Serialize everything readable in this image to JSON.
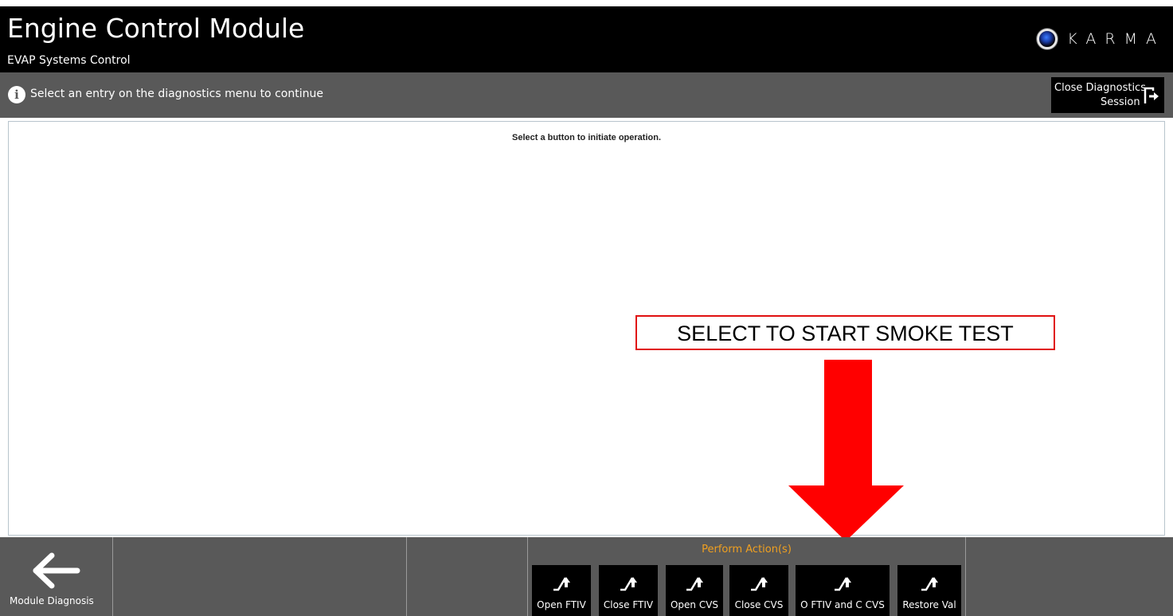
{
  "header": {
    "title": "Engine Control Module",
    "subtitle": "EVAP Systems Control",
    "brand": "KARMA"
  },
  "infobar": {
    "message": "Select an entry on the diagnostics menu to continue",
    "close_line1": "Close Diagnostics",
    "close_line2": "Session"
  },
  "content": {
    "hint": "Select a button to initiate operation."
  },
  "annotation": {
    "text": "SELECT TO START SMOKE TEST",
    "color": "#e01010"
  },
  "bottom": {
    "back_label": "Module Diagnosis",
    "perform_title": "Perform Action(s)",
    "actions": [
      {
        "label": "Open FTIV"
      },
      {
        "label": "Close FTIV"
      },
      {
        "label": "Open CVS"
      },
      {
        "label": "Close CVS"
      },
      {
        "label": "O FTIV and C CVS"
      },
      {
        "label": "Restore Val"
      }
    ]
  },
  "colors": {
    "header_bg": "#000000",
    "bar_bg": "#595959",
    "accent_orange": "#f0a020"
  }
}
